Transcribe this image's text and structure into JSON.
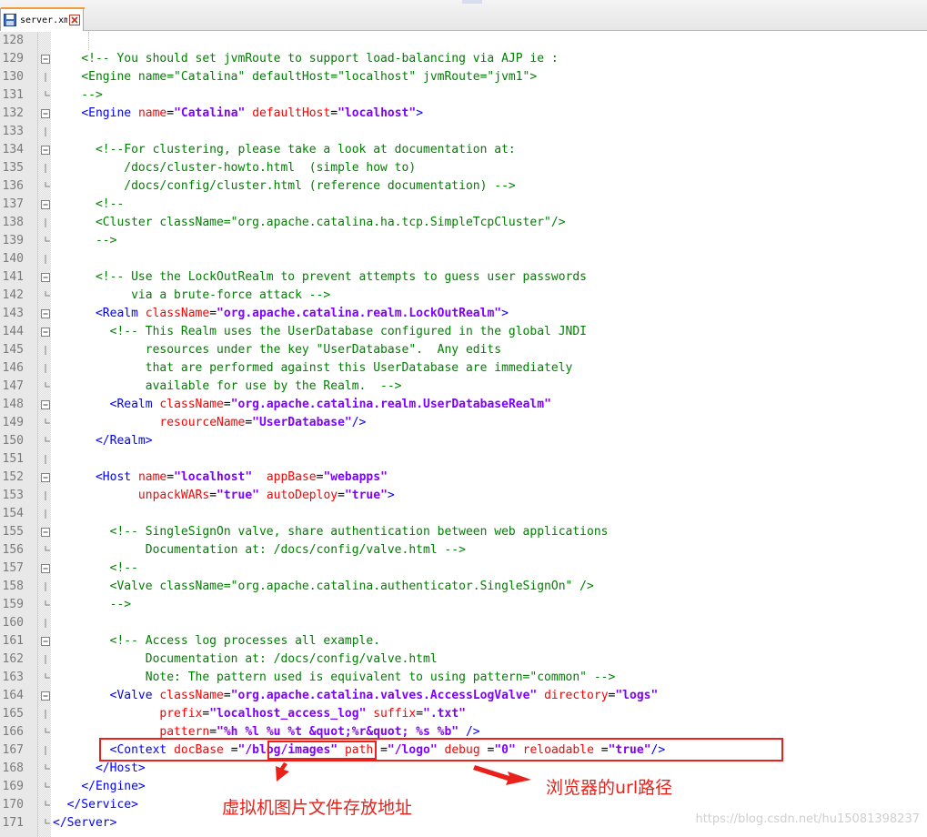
{
  "tab": {
    "title": "server.xml"
  },
  "colors": {
    "comment": "#008000",
    "tag": "#0000ff",
    "attribute": "#ff0000",
    "value": "#8000ff",
    "annotation": "#e8211a"
  },
  "lines": [
    {
      "n": "128",
      "fold": "",
      "tokens": []
    },
    {
      "n": "129",
      "fold": "box",
      "tokens": [
        [
          "c",
          "    <!-- You should set jvmRoute to support load-balancing via AJP ie :"
        ]
      ]
    },
    {
      "n": "130",
      "fold": "line",
      "tokens": [
        [
          "c",
          "    <Engine name=\"Catalina\" defaultHost=\"localhost\" jvmRoute=\"jvm1\">"
        ]
      ]
    },
    {
      "n": "131",
      "fold": "end",
      "tokens": [
        [
          "c",
          "    -->"
        ]
      ]
    },
    {
      "n": "132",
      "fold": "box",
      "tokens": [
        [
          "w",
          "    "
        ],
        [
          "t",
          "<Engine"
        ],
        [
          "w",
          " "
        ],
        [
          "a",
          "name"
        ],
        [
          "w",
          "="
        ],
        [
          "v",
          "\"Catalina\""
        ],
        [
          "w",
          " "
        ],
        [
          "a",
          "defaultHost"
        ],
        [
          "w",
          "="
        ],
        [
          "v",
          "\"localhost\""
        ],
        [
          "t",
          ">"
        ]
      ]
    },
    {
      "n": "133",
      "fold": "line",
      "tokens": []
    },
    {
      "n": "134",
      "fold": "box",
      "tokens": [
        [
          "c",
          "      <!--For clustering, please take a look at documentation at:"
        ]
      ]
    },
    {
      "n": "135",
      "fold": "line",
      "tokens": [
        [
          "c",
          "          /docs/cluster-howto.html  (simple how to)"
        ]
      ]
    },
    {
      "n": "136",
      "fold": "end",
      "tokens": [
        [
          "c",
          "          /docs/config/cluster.html (reference documentation) -->"
        ]
      ]
    },
    {
      "n": "137",
      "fold": "box",
      "tokens": [
        [
          "c",
          "      <!--"
        ]
      ]
    },
    {
      "n": "138",
      "fold": "line",
      "tokens": [
        [
          "c",
          "      <Cluster className=\"org.apache.catalina.ha.tcp.SimpleTcpCluster\"/>"
        ]
      ]
    },
    {
      "n": "139",
      "fold": "end",
      "tokens": [
        [
          "c",
          "      -->"
        ]
      ]
    },
    {
      "n": "140",
      "fold": "line",
      "tokens": []
    },
    {
      "n": "141",
      "fold": "box",
      "tokens": [
        [
          "c",
          "      <!-- Use the LockOutRealm to prevent attempts to guess user passwords"
        ]
      ]
    },
    {
      "n": "142",
      "fold": "end",
      "tokens": [
        [
          "c",
          "           via a brute-force attack -->"
        ]
      ]
    },
    {
      "n": "143",
      "fold": "box",
      "tokens": [
        [
          "w",
          "      "
        ],
        [
          "t",
          "<Realm"
        ],
        [
          "w",
          " "
        ],
        [
          "a",
          "className"
        ],
        [
          "w",
          "="
        ],
        [
          "v",
          "\"org.apache.catalina.realm.LockOutRealm\""
        ],
        [
          "t",
          ">"
        ]
      ]
    },
    {
      "n": "144",
      "fold": "box",
      "tokens": [
        [
          "c",
          "        <!-- This Realm uses the UserDatabase configured in the global JNDI"
        ]
      ]
    },
    {
      "n": "145",
      "fold": "line",
      "tokens": [
        [
          "c",
          "             resources under the key \"UserDatabase\".  Any edits"
        ]
      ]
    },
    {
      "n": "146",
      "fold": "line",
      "tokens": [
        [
          "c",
          "             that are performed against this UserDatabase are immediately"
        ]
      ]
    },
    {
      "n": "147",
      "fold": "end",
      "tokens": [
        [
          "c",
          "             available for use by the Realm.  -->"
        ]
      ]
    },
    {
      "n": "148",
      "fold": "box",
      "tokens": [
        [
          "w",
          "        "
        ],
        [
          "t",
          "<Realm"
        ],
        [
          "w",
          " "
        ],
        [
          "a",
          "className"
        ],
        [
          "w",
          "="
        ],
        [
          "v",
          "\"org.apache.catalina.realm.UserDatabaseRealm\""
        ]
      ]
    },
    {
      "n": "149",
      "fold": "end",
      "tokens": [
        [
          "w",
          "               "
        ],
        [
          "a",
          "resourceName"
        ],
        [
          "w",
          "="
        ],
        [
          "v",
          "\"UserDatabase\""
        ],
        [
          "t",
          "/>"
        ]
      ]
    },
    {
      "n": "150",
      "fold": "end",
      "tokens": [
        [
          "w",
          "      "
        ],
        [
          "t",
          "</Realm>"
        ]
      ]
    },
    {
      "n": "151",
      "fold": "line",
      "tokens": []
    },
    {
      "n": "152",
      "fold": "box",
      "tokens": [
        [
          "w",
          "      "
        ],
        [
          "t",
          "<Host"
        ],
        [
          "w",
          " "
        ],
        [
          "a",
          "name"
        ],
        [
          "w",
          "="
        ],
        [
          "v",
          "\"localhost\""
        ],
        [
          "w",
          "  "
        ],
        [
          "a",
          "appBase"
        ],
        [
          "w",
          "="
        ],
        [
          "v",
          "\"webapps\""
        ]
      ]
    },
    {
      "n": "153",
      "fold": "line",
      "tokens": [
        [
          "w",
          "            "
        ],
        [
          "a",
          "unpackWARs"
        ],
        [
          "w",
          "="
        ],
        [
          "v",
          "\"true\""
        ],
        [
          "w",
          " "
        ],
        [
          "a",
          "autoDeploy"
        ],
        [
          "w",
          "="
        ],
        [
          "v",
          "\"true\""
        ],
        [
          "t",
          ">"
        ]
      ]
    },
    {
      "n": "154",
      "fold": "line",
      "tokens": []
    },
    {
      "n": "155",
      "fold": "box",
      "tokens": [
        [
          "c",
          "        <!-- SingleSignOn valve, share authentication between web applications"
        ]
      ]
    },
    {
      "n": "156",
      "fold": "end",
      "tokens": [
        [
          "c",
          "             Documentation at: /docs/config/valve.html -->"
        ]
      ]
    },
    {
      "n": "157",
      "fold": "box",
      "tokens": [
        [
          "c",
          "        <!--"
        ]
      ]
    },
    {
      "n": "158",
      "fold": "line",
      "tokens": [
        [
          "c",
          "        <Valve className=\"org.apache.catalina.authenticator.SingleSignOn\" />"
        ]
      ]
    },
    {
      "n": "159",
      "fold": "end",
      "tokens": [
        [
          "c",
          "        -->"
        ]
      ]
    },
    {
      "n": "160",
      "fold": "line",
      "tokens": []
    },
    {
      "n": "161",
      "fold": "box",
      "tokens": [
        [
          "c",
          "        <!-- Access log processes all example."
        ]
      ]
    },
    {
      "n": "162",
      "fold": "line",
      "tokens": [
        [
          "c",
          "             Documentation at: /docs/config/valve.html"
        ]
      ]
    },
    {
      "n": "163",
      "fold": "end",
      "tokens": [
        [
          "c",
          "             Note: The pattern used is equivalent to using pattern=\"common\" -->"
        ]
      ]
    },
    {
      "n": "164",
      "fold": "box",
      "tokens": [
        [
          "w",
          "        "
        ],
        [
          "t",
          "<Valve"
        ],
        [
          "w",
          " "
        ],
        [
          "a",
          "className"
        ],
        [
          "w",
          "="
        ],
        [
          "v",
          "\"org.apache.catalina.valves.AccessLogValve\""
        ],
        [
          "w",
          " "
        ],
        [
          "a",
          "directory"
        ],
        [
          "w",
          "="
        ],
        [
          "v",
          "\"logs\""
        ]
      ]
    },
    {
      "n": "165",
      "fold": "line",
      "tokens": [
        [
          "w",
          "               "
        ],
        [
          "a",
          "prefix"
        ],
        [
          "w",
          "="
        ],
        [
          "v",
          "\"localhost_access_log\""
        ],
        [
          "w",
          " "
        ],
        [
          "a",
          "suffix"
        ],
        [
          "w",
          "="
        ],
        [
          "v",
          "\".txt\""
        ]
      ]
    },
    {
      "n": "166",
      "fold": "end",
      "tokens": [
        [
          "w",
          "               "
        ],
        [
          "a",
          "pattern"
        ],
        [
          "w",
          "="
        ],
        [
          "v",
          "\"%h %l %u %t &quot;%r&quot; %s %b\""
        ],
        [
          "w",
          " "
        ],
        [
          "t",
          "/>"
        ]
      ]
    },
    {
      "n": "167",
      "fold": "line",
      "tokens": [
        [
          "w",
          "        "
        ],
        [
          "t",
          "<Context"
        ],
        [
          "w",
          " "
        ],
        [
          "a",
          "docBase"
        ],
        [
          "w",
          " ="
        ],
        [
          "v",
          "\"/blog/images\""
        ],
        [
          "w",
          " "
        ],
        [
          "a",
          "path"
        ],
        [
          "w",
          " ="
        ],
        [
          "v",
          "\"/logo\""
        ],
        [
          "w",
          " "
        ],
        [
          "a",
          "debug"
        ],
        [
          "w",
          " ="
        ],
        [
          "v",
          "\"0\""
        ],
        [
          "w",
          " "
        ],
        [
          "a",
          "reloadable"
        ],
        [
          "w",
          " ="
        ],
        [
          "v",
          "\"true\""
        ],
        [
          "t",
          "/>"
        ]
      ]
    },
    {
      "n": "168",
      "fold": "end",
      "tokens": [
        [
          "w",
          "      "
        ],
        [
          "t",
          "</Host>"
        ]
      ]
    },
    {
      "n": "169",
      "fold": "end",
      "tokens": [
        [
          "w",
          "    "
        ],
        [
          "t",
          "</Engine>"
        ]
      ]
    },
    {
      "n": "170",
      "fold": "end",
      "tokens": [
        [
          "w",
          "  "
        ],
        [
          "t",
          "</Service>"
        ]
      ]
    },
    {
      "n": "171",
      "fold": "end",
      "tokens": [
        [
          "t",
          "</Server>"
        ]
      ]
    }
  ],
  "annotations": {
    "left_label": "虚拟机图片文件存放地址",
    "right_label": "浏览器的url路径"
  },
  "watermark": "https://blog.csdn.net/hu15081398237"
}
